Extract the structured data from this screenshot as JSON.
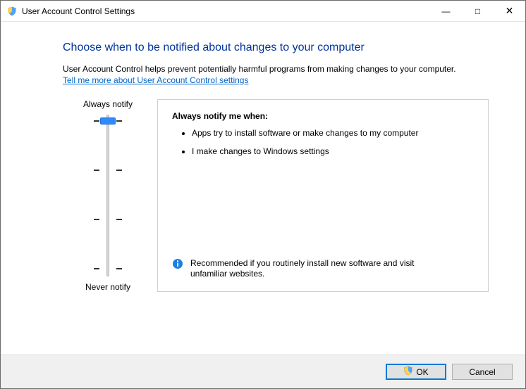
{
  "window": {
    "title": "User Account Control Settings"
  },
  "page": {
    "heading": "Choose when to be notified about changes to your computer",
    "description": "User Account Control helps prevent potentially harmful programs from making changes to your computer.",
    "help_link": "Tell me more about User Account Control settings"
  },
  "slider": {
    "top_label": "Always notify",
    "bottom_label": "Never notify",
    "levels": 4,
    "current_level": 3
  },
  "panel": {
    "title": "Always notify me when:",
    "bullets": [
      "Apps try to install software or make changes to my computer",
      "I make changes to Windows settings"
    ],
    "recommendation": "Recommended if you routinely install new software and visit unfamiliar websites."
  },
  "footer": {
    "ok": "OK",
    "cancel": "Cancel"
  }
}
